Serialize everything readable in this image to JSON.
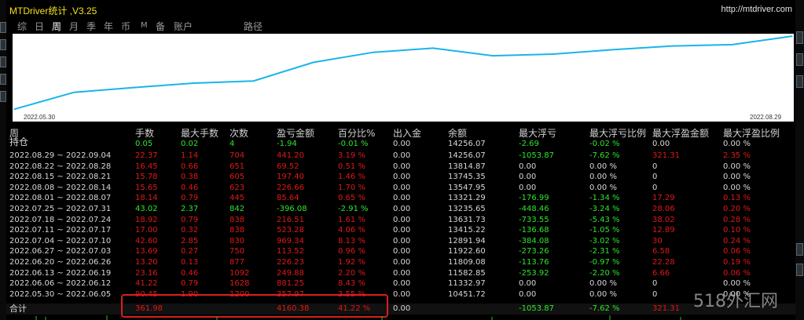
{
  "app": {
    "title": "MTDriver统计 ,V3.25",
    "url": "http://mtdriver.com"
  },
  "tabs": [
    "综",
    "日",
    "周",
    "月",
    "季",
    "年",
    "币",
    "M",
    "备",
    "账户",
    "路径"
  ],
  "active_tab": "周",
  "chart": {
    "start_label": "2022.05.30",
    "end_label": "2022.08.29",
    "line_color": "#1ab4ea",
    "chart_data": {
      "type": "line",
      "x": [
        "2022.05.30",
        "2022.06.06",
        "2022.06.13",
        "2022.06.20",
        "2022.06.27",
        "2022.07.04",
        "2022.07.11",
        "2022.07.18",
        "2022.07.25",
        "2022.08.01",
        "2022.08.08",
        "2022.08.15",
        "2022.08.22",
        "2022.08.29"
      ],
      "values": [
        10451.72,
        11332.97,
        11582.85,
        11809.08,
        11922.6,
        12891.94,
        13415.22,
        13631.73,
        13235.65,
        13321.29,
        13547.95,
        13745.35,
        13814.87,
        14256.07
      ]
    }
  },
  "table": {
    "headers": {
      "period": "周",
      "lots": "手数",
      "max_lots": "最大手数",
      "count": "次数",
      "pnl": "盈亏金额",
      "pct": "百分比%",
      "inout": "出入金",
      "balance": "余额",
      "max_float_loss": "最大浮亏",
      "max_float_loss_pct": "最大浮亏比例",
      "max_float_profit": "最大浮盈金额",
      "max_float_profit_pct": "最大浮盈比例"
    },
    "holding": {
      "label": "持仓",
      "lots": "0.05",
      "max_lots": "0.02",
      "count": "4",
      "pnl": "-1.94",
      "pct": "-0.01 %",
      "inout": "0.00",
      "balance": "14256.07",
      "max_float_loss": "-2.69",
      "max_float_loss_pct": "-0.02 %",
      "max_float_profit": "0.00",
      "max_float_profit_pct": "0.00 %"
    },
    "rows": [
      {
        "period": "2022.08.29 ~ 2022.09.04",
        "lots": "22.37",
        "max_lots": "1.14",
        "count": "704",
        "pnl": "441.20",
        "pct": "3.19 %",
        "inout": "0.00",
        "balance": "14256.07",
        "mfl": "-1053.87",
        "mflp": "-7.62 %",
        "mfp": "321.31",
        "mfpp": "2.35 %",
        "color": "red",
        "mfl_color": "green",
        "mfp_color": "red"
      },
      {
        "period": "2022.08.22 ~ 2022.08.28",
        "lots": "16.45",
        "max_lots": "0.66",
        "count": "651",
        "pnl": "69.52",
        "pct": "0.51 %",
        "inout": "0.00",
        "balance": "13814.87",
        "mfl": "0.00",
        "mflp": "0.00 %",
        "mfp": "0",
        "mfpp": "0.00 %",
        "color": "red",
        "mfl_color": "white",
        "mfp_color": "white"
      },
      {
        "period": "2022.08.15 ~ 2022.08.21",
        "lots": "15.78",
        "max_lots": "0.38",
        "count": "605",
        "pnl": "197.40",
        "pct": "1.46 %",
        "inout": "0.00",
        "balance": "13745.35",
        "mfl": "0.00",
        "mflp": "0.00 %",
        "mfp": "0",
        "mfpp": "0.00 %",
        "color": "red",
        "mfl_color": "white",
        "mfp_color": "white"
      },
      {
        "period": "2022.08.08 ~ 2022.08.14",
        "lots": "15.65",
        "max_lots": "0.46",
        "count": "623",
        "pnl": "226.66",
        "pct": "1.70 %",
        "inout": "0.00",
        "balance": "13547.95",
        "mfl": "0.00",
        "mflp": "0.00 %",
        "mfp": "0",
        "mfpp": "0.00 %",
        "color": "red",
        "mfl_color": "white",
        "mfp_color": "white"
      },
      {
        "period": "2022.08.01 ~ 2022.08.07",
        "lots": "18.14",
        "max_lots": "0.79",
        "count": "445",
        "pnl": "85.64",
        "pct": "0.65 %",
        "inout": "0.00",
        "balance": "13321.29",
        "mfl": "-176.99",
        "mflp": "-1.34 %",
        "mfp": "17.29",
        "mfpp": "0.13 %",
        "color": "red",
        "mfl_color": "green",
        "mfp_color": "red"
      },
      {
        "period": "2022.07.25 ~ 2022.07.31",
        "lots": "43.02",
        "max_lots": "2.37",
        "count": "842",
        "pnl": "-396.08",
        "pct": "-2.91 %",
        "inout": "0.00",
        "balance": "13235.65",
        "mfl": "-448.46",
        "mflp": "-3.24 %",
        "mfp": "28.06",
        "mfpp": "0.20 %",
        "color": "green",
        "mfl_color": "green",
        "mfp_color": "red"
      },
      {
        "period": "2022.07.18 ~ 2022.07.24",
        "lots": "18.92",
        "max_lots": "0.79",
        "count": "838",
        "pnl": "216.51",
        "pct": "1.61 %",
        "inout": "0.00",
        "balance": "13631.73",
        "mfl": "-733.55",
        "mflp": "-5.43 %",
        "mfp": "38.02",
        "mfpp": "0.28 %",
        "color": "red",
        "mfl_color": "green",
        "mfp_color": "red"
      },
      {
        "period": "2022.07.11 ~ 2022.07.17",
        "lots": "17.00",
        "max_lots": "0.32",
        "count": "838",
        "pnl": "523.28",
        "pct": "4.06 %",
        "inout": "0.00",
        "balance": "13415.22",
        "mfl": "-136.68",
        "mflp": "-1.05 %",
        "mfp": "12.89",
        "mfpp": "0.10 %",
        "color": "red",
        "mfl_color": "green",
        "mfp_color": "red"
      },
      {
        "period": "2022.07.04 ~ 2022.07.10",
        "lots": "42.60",
        "max_lots": "2.85",
        "count": "830",
        "pnl": "969.34",
        "pct": "8.13 %",
        "inout": "0.00",
        "balance": "12891.94",
        "mfl": "-384.08",
        "mflp": "-3.02 %",
        "mfp": "30",
        "mfpp": "0.24 %",
        "color": "red",
        "mfl_color": "green",
        "mfp_color": "red"
      },
      {
        "period": "2022.06.27 ~ 2022.07.03",
        "lots": "13.69",
        "max_lots": "0.27",
        "count": "750",
        "pnl": "113.52",
        "pct": "0.96 %",
        "inout": "0.00",
        "balance": "11922.60",
        "mfl": "-273.26",
        "mflp": "-2.31 %",
        "mfp": "6.58",
        "mfpp": "0.06 %",
        "color": "red",
        "mfl_color": "green",
        "mfp_color": "red"
      },
      {
        "period": "2022.06.20 ~ 2022.06.26",
        "lots": "13.20",
        "max_lots": "0.13",
        "count": "877",
        "pnl": "226.23",
        "pct": "1.92 %",
        "inout": "0.00",
        "balance": "11809.08",
        "mfl": "-113.76",
        "mflp": "-0.97 %",
        "mfp": "22.28",
        "mfpp": "0.19 %",
        "color": "red",
        "mfl_color": "green",
        "mfp_color": "red"
      },
      {
        "period": "2022.06.13 ~ 2022.06.19",
        "lots": "23.16",
        "max_lots": "0.46",
        "count": "1092",
        "pnl": "249.88",
        "pct": "2.20 %",
        "inout": "0.00",
        "balance": "11582.85",
        "mfl": "-253.92",
        "mflp": "-2.20 %",
        "mfp": "6.66",
        "mfpp": "0.06 %",
        "color": "red",
        "mfl_color": "green",
        "mfp_color": "red"
      },
      {
        "period": "2022.06.06 ~ 2022.06.12",
        "lots": "41.22",
        "max_lots": "0.79",
        "count": "1628",
        "pnl": "881.25",
        "pct": "8.43 %",
        "inout": "0.00",
        "balance": "11332.97",
        "mfl": "0.00",
        "mflp": "0.00 %",
        "mfp": "0",
        "mfpp": "0.00 %",
        "color": "red",
        "mfl_color": "white",
        "mfp_color": "white"
      },
      {
        "period": "2022.05.30 ~ 2022.06.05",
        "lots": "90.45",
        "max_lots": "1.90",
        "count": "1200",
        "pnl": "357.97",
        "pct": "3.55 %",
        "inout": "0.00",
        "balance": "10451.72",
        "mfl": "0.00",
        "mflp": "0.00 %",
        "mfp": "0",
        "mfpp": "0.00 %",
        "color": "red",
        "mfl_color": "white",
        "mfp_color": "white"
      }
    ],
    "total": {
      "label": "合计",
      "lots": "361.98",
      "pnl": "4160.38",
      "pct": "41.22 %",
      "inout": "0.00",
      "mfl": "-1053.87",
      "mflp": "-7.62 %",
      "mfp": "321.31"
    }
  },
  "watermark": "518外汇网"
}
